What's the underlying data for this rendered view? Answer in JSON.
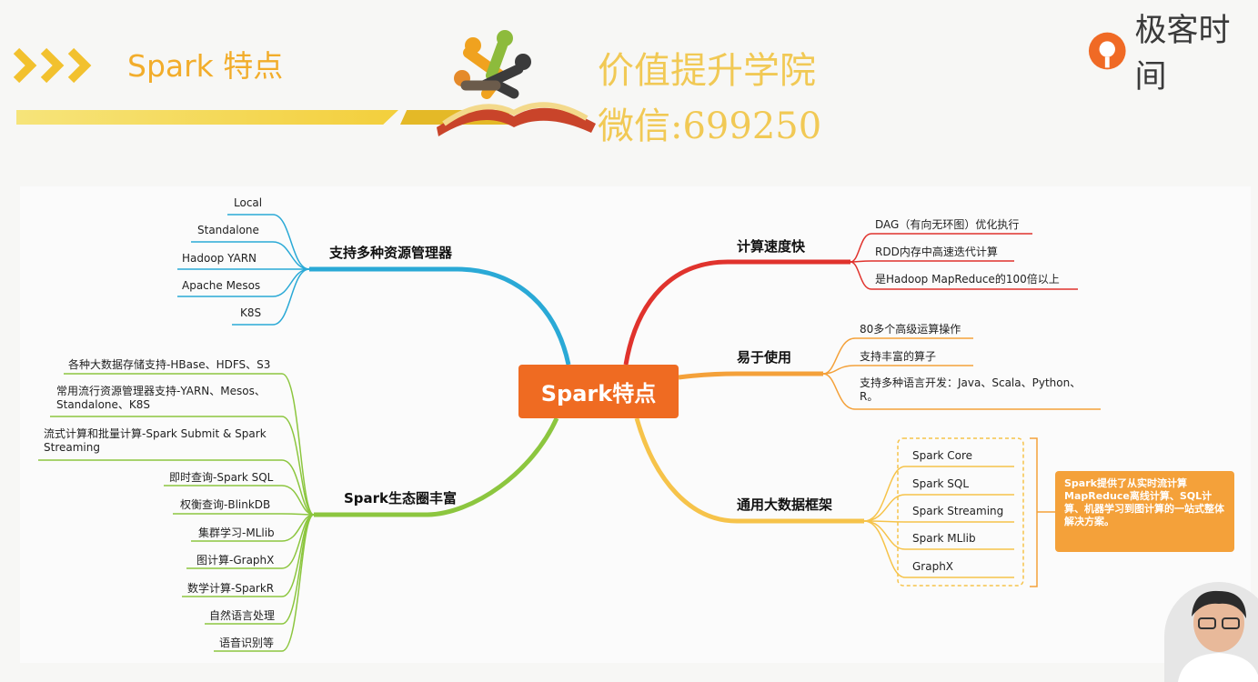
{
  "header": {
    "title": "Spark 特点",
    "watermark_line1": "价值提升学院",
    "watermark_line2": "微信:699250",
    "brand": "极客时间"
  },
  "mindmap": {
    "center": "Spark特点",
    "branches": {
      "resource_managers": {
        "label": "支持多种资源管理器",
        "items": [
          "Local",
          "Standalone",
          "Hadoop YARN",
          "Apache Mesos",
          "K8S"
        ]
      },
      "ecosystem": {
        "label": "Spark生态圈丰富",
        "items": [
          "各种大数据存储支持-HBase、HDFS、S3",
          "常用流行资源管理器支持-YARN、Mesos、Standalone、K8S",
          "流式计算和批量计算-Spark Submit & Spark Streaming",
          "即时查询-Spark SQL",
          "权衡查询-BlinkDB",
          "集群学习-MLlib",
          "图计算-GraphX",
          "数学计算-SparkR",
          "自然语言处理",
          "语音识别等"
        ]
      },
      "speed": {
        "label": "计算速度快",
        "items": [
          "DAG（有向无环图）优化执行",
          "RDD内存中高速迭代计算",
          "是Hadoop MapReduce的100倍以上"
        ]
      },
      "ease": {
        "label": "易于使用",
        "items": [
          "80多个高级运算操作",
          "支持丰富的算子",
          "支持多种语言开发：Java、Scala、Python、R。"
        ]
      },
      "framework": {
        "label": "通用大数据框架",
        "items": [
          "Spark Core",
          "Spark SQL",
          "Spark Streaming",
          "Spark MLlib",
          "GraphX"
        ],
        "note": "Spark提供了从实时流计算 MapReduce离线计算、SQL计算、机器学习到图计算的一站式整体解决方案。"
      }
    }
  },
  "colors": {
    "resource_managers": "#2aa9d6",
    "ecosystem": "#8cc63f",
    "speed": "#e0332d",
    "ease": "#f4a13a",
    "framework": "#f6c34a",
    "center": "#ef6b22"
  }
}
